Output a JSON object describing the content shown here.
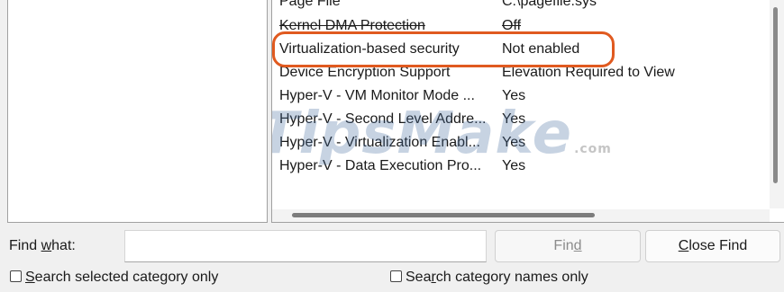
{
  "details": {
    "rows": [
      {
        "item": "Page File",
        "value": "C:\\pagefile.sys"
      },
      {
        "item": "Kernel DMA Protection",
        "value": "Off"
      },
      {
        "item": "Virtualization-based security",
        "value": "Not enabled"
      },
      {
        "item": "Device Encryption Support",
        "value": "Elevation Required to View"
      },
      {
        "item": "Hyper-V - VM Monitor Mode ...",
        "value": "Yes"
      },
      {
        "item": "Hyper-V - Second Level Addre...",
        "value": "Yes"
      },
      {
        "item": "Hyper-V - Virtualization Enabl...",
        "value": "Yes"
      },
      {
        "item": "Hyper-V - Data Execution Pro...",
        "value": "Yes"
      }
    ],
    "highlight_color": "#e05a20"
  },
  "watermark": {
    "text": "TipsMake",
    "suffix": ".com"
  },
  "find": {
    "label_pre": "Find ",
    "label_key": "w",
    "label_post": "hat:",
    "value": "",
    "find_button_pre": "Fin",
    "find_button_key": "d",
    "find_button_post": "",
    "close_button_pre": "",
    "close_button_key": "C",
    "close_button_post": "lose Find"
  },
  "options": {
    "search_selected_pre": "",
    "search_selected_key": "S",
    "search_selected_post": "earch selected category only",
    "search_names_pre": "Sea",
    "search_names_key": "r",
    "search_names_post": "ch category names only"
  }
}
